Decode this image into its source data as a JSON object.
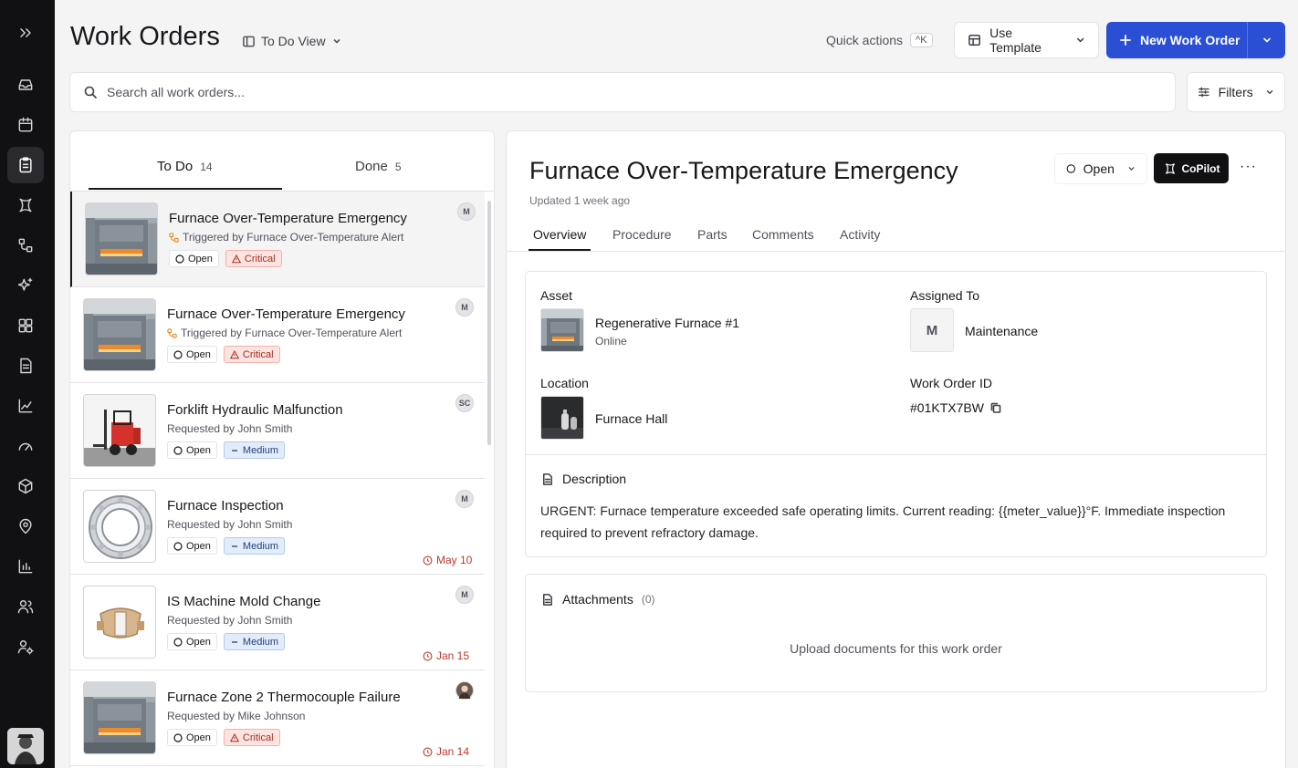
{
  "page": {
    "title": "Work Orders",
    "view": "To Do View"
  },
  "header": {
    "quick_actions": "Quick actions",
    "shortcut": "^K",
    "use_template": "Use Template",
    "new_work_order": "New Work Order"
  },
  "search": {
    "placeholder": "Search all work orders..."
  },
  "filters": {
    "label": "Filters"
  },
  "list": {
    "tabs": [
      {
        "label": "To Do",
        "count": "14"
      },
      {
        "label": "Done",
        "count": "5"
      }
    ],
    "items": [
      {
        "title": "Furnace Over-Temperature Emergency",
        "subtitle": "Triggered by Furnace Over-Temperature Alert",
        "status": "Open",
        "priority": "Critical",
        "assignee": "M",
        "due": "",
        "thumb": "furnace"
      },
      {
        "title": "Furnace Over-Temperature Emergency",
        "subtitle": "Triggered by Furnace Over-Temperature Alert",
        "status": "Open",
        "priority": "Critical",
        "assignee": "M",
        "due": "",
        "thumb": "furnace"
      },
      {
        "title": "Forklift Hydraulic Malfunction",
        "subtitle": "Requested by John Smith",
        "status": "Open",
        "priority": "Medium",
        "assignee": "SC",
        "due": "",
        "thumb": "forklift"
      },
      {
        "title": "Furnace Inspection",
        "subtitle": "Requested by John Smith",
        "status": "Open",
        "priority": "Medium",
        "assignee": "M",
        "due": "May 10",
        "thumb": "bearing"
      },
      {
        "title": "IS Machine Mold Change",
        "subtitle": "Requested by John Smith",
        "status": "Open",
        "priority": "Medium",
        "assignee": "M",
        "due": "Jan 15",
        "thumb": "mold"
      },
      {
        "title": "Furnace Zone 2 Thermocouple Failure",
        "subtitle": "Requested by Mike Johnson",
        "status": "Open",
        "priority": "Critical",
        "assignee": "",
        "due": "Jan 14",
        "thumb": "furnace"
      }
    ]
  },
  "detail": {
    "title": "Furnace Over-Temperature Emergency",
    "updated": "Updated 1 week ago",
    "status": "Open",
    "copilot": "CoPilot",
    "more": "···",
    "tabs": [
      "Overview",
      "Procedure",
      "Parts",
      "Comments",
      "Activity"
    ],
    "asset_label": "Asset",
    "asset_name": "Regenerative Furnace #1",
    "asset_status": "Online",
    "assigned_label": "Assigned To",
    "assigned_initial": "M",
    "assigned_name": "Maintenance",
    "location_label": "Location",
    "location_name": "Furnace Hall",
    "woid_label": "Work Order ID",
    "woid": "#01KTX7BW",
    "description_label": "Description",
    "description": "URGENT: Furnace temperature exceeded safe operating limits. Current reading: {{meter_value}}°F. Immediate inspection required to prevent refractory damage.",
    "attachments_label": "Attachments",
    "attachments_count": "(0)",
    "upload_text": "Upload documents for this work order"
  },
  "colors": {
    "primary": "#2b4fd4",
    "critical": "#a02f1f",
    "medium": "#24407a",
    "sidebar": "#111113",
    "due": "#c0392b"
  }
}
